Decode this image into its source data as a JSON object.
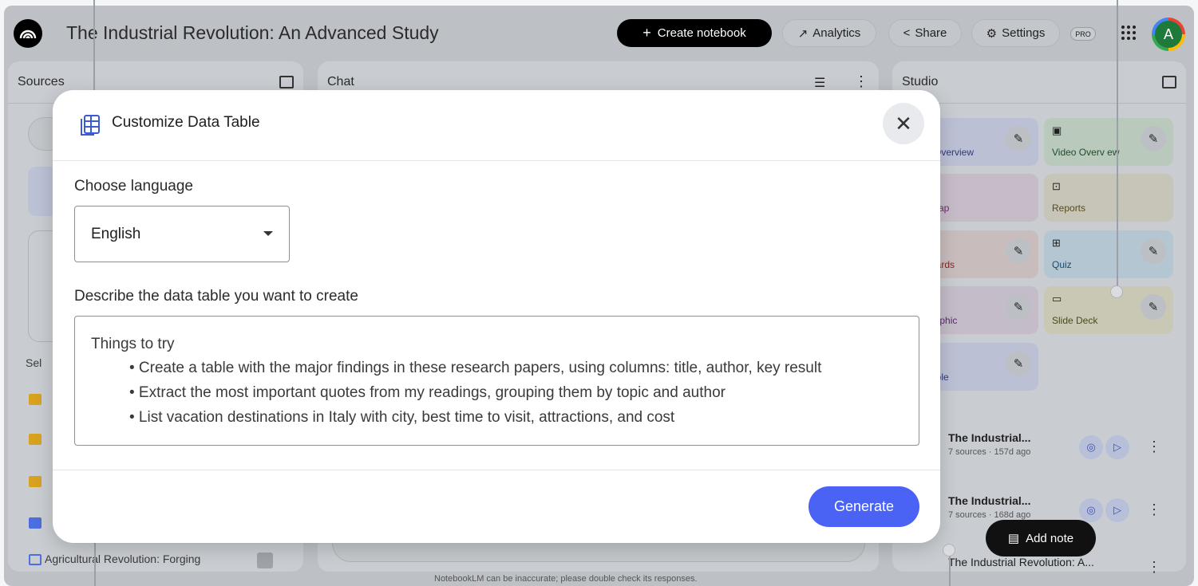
{
  "header": {
    "title": "The Industrial Revolution: An Advanced Study",
    "create_label": "Create notebook",
    "analytics_label": "Analytics",
    "share_label": "Share",
    "settings_label": "Settings",
    "pro_label": "PRO",
    "avatar_initial": "A"
  },
  "sources": {
    "title": "Sources",
    "select_prefix": "Sel",
    "bottom_item": "Agricultural Revolution: Forging"
  },
  "chat": {
    "title": "Chat",
    "disclaimer": "NotebookLM can be inaccurate; please double check its responses."
  },
  "studio": {
    "title": "Studio",
    "tiles": [
      {
        "label": "o Overview"
      },
      {
        "label": "Video Overv ew"
      },
      {
        "label": "l Map"
      },
      {
        "label": "Reports"
      },
      {
        "label": "ncards"
      },
      {
        "label": "Quiz"
      },
      {
        "label": "graphic"
      },
      {
        "label": "Slide Deck"
      },
      {
        "label": "Table"
      }
    ],
    "notes": [
      {
        "title": "The Industrial...",
        "meta": "7 sources · 157d ago"
      },
      {
        "title": "The Industrial...",
        "meta": "7 sources · 168d ago"
      },
      {
        "title": "The Industrial Revolution: A..."
      }
    ],
    "add_note_label": "Add note"
  },
  "modal": {
    "title": "Customize Data Table",
    "language_label": "Choose language",
    "language_value": "English",
    "describe_label": "Describe the data table you want to create",
    "hint_head": "Things to try",
    "hints": [
      "• Create a table with the major findings in these research papers, using columns: title, author, key result",
      "• Extract the most important quotes from my readings, grouping them by topic and author",
      "• List vacation destinations in Italy with city, best time to visit, attractions, and cost"
    ],
    "generate_label": "Generate"
  },
  "colors": {
    "accent": "#4a63f5",
    "backdrop": "#bdc1c6"
  }
}
